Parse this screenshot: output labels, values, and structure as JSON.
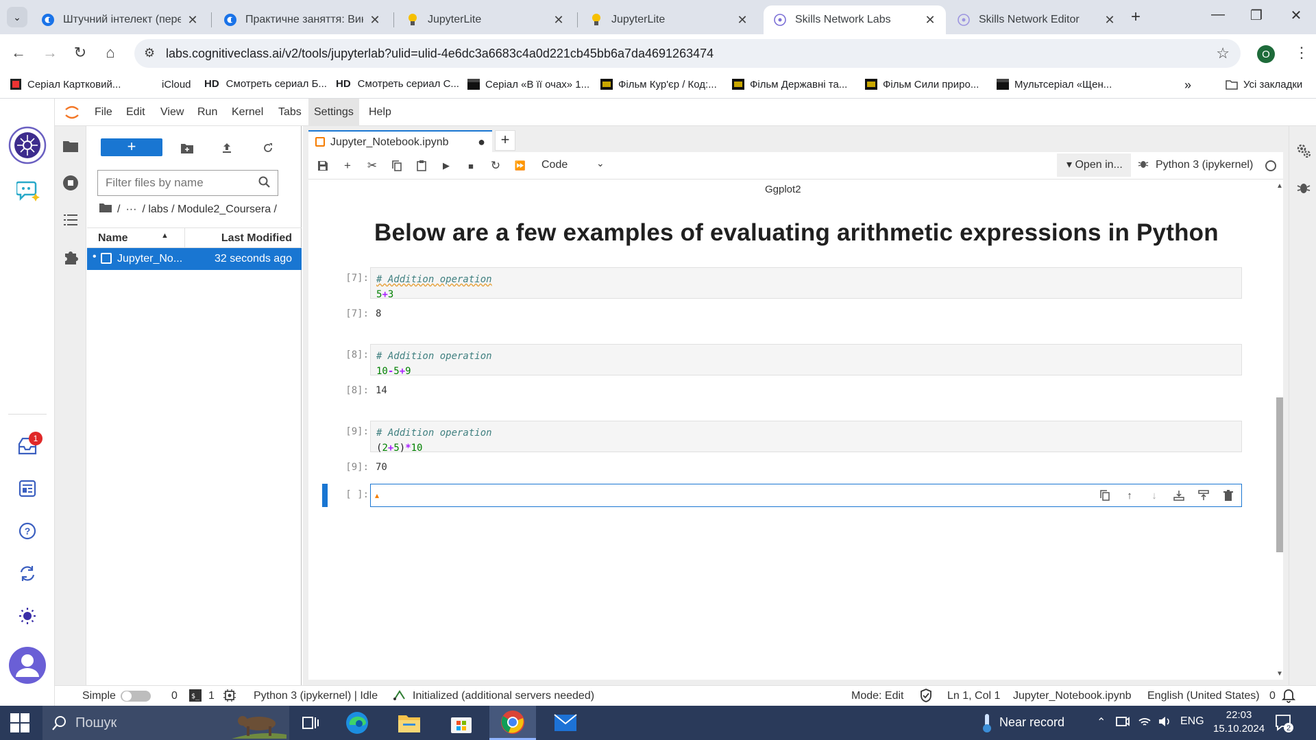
{
  "browser": {
    "tabs": [
      {
        "title": "Штучний інтелект (перекл",
        "icon": "coursera-icon",
        "active": false
      },
      {
        "title": "Практичне заняття: Викор",
        "icon": "coursera-icon",
        "active": false
      },
      {
        "title": "JupyterLite",
        "icon": "jupyterlite-icon",
        "active": false
      },
      {
        "title": "JupyterLite",
        "icon": "jupyterlite-icon",
        "active": false
      },
      {
        "title": "Skills Network Labs",
        "icon": "skills-network-icon",
        "active": true
      },
      {
        "title": "Skills Network Editor",
        "icon": "skills-network-icon",
        "active": false
      }
    ],
    "url": "labs.cognitiveclass.ai/v2/tools/jupyterlab?ulid=ulid-4e6dc3a6683c4a0d221cb45bb6a7da4691263474",
    "profile_initial": "O",
    "bookmarks": [
      {
        "label": "Серіал Картковий...",
        "icon": "youtube-icon"
      },
      {
        "label": "iCloud",
        "icon": "apple-icon"
      },
      {
        "label": "Смотреть сериал Б...",
        "prefix": "HD"
      },
      {
        "label": "Смотреть сериал С...",
        "prefix": "HD"
      },
      {
        "label": "Серіал «В її очах» 1...",
        "icon": "clapper-icon"
      },
      {
        "label": "Фільм Кур'єр / Код:...",
        "icon": "film-icon"
      },
      {
        "label": "Фільм Державні та...",
        "icon": "film-icon"
      },
      {
        "label": "Фільм Сили приро...",
        "icon": "film-icon"
      },
      {
        "label": "Мультсеріал «Щен...",
        "icon": "clapper-icon"
      }
    ],
    "bookmarks_overflow": "»",
    "all_bookmarks": "Усі закладки"
  },
  "menu": {
    "items": [
      "File",
      "Edit",
      "View",
      "Run",
      "Kernel",
      "Tabs",
      "Settings",
      "Help"
    ]
  },
  "sn_rail": {
    "badge_count": "1"
  },
  "filebrowser": {
    "new_label": "+",
    "filter_placeholder": "Filter files by name",
    "breadcrumb": {
      "root": "/",
      "ellipsis": "···",
      "path": "/ labs / Module2_Coursera /"
    },
    "headers": {
      "name": "Name",
      "modified": "Last Modified"
    },
    "files": [
      {
        "name": "Jupyter_No...",
        "modified": "32 seconds ago",
        "selected": true
      }
    ]
  },
  "notebook": {
    "tab_title": "Jupyter_Notebook.ipynb",
    "dirty_marker": "●",
    "cell_type": "Code",
    "open_in": "▾ Open in...",
    "kernel": "Python 3 (ipykernel)",
    "top_text": "Ggplot2",
    "heading": "Below are a few examples of evaluating arithmetic expressions in Python",
    "cells": [
      {
        "in_prompt": "[7]:",
        "comment": "# Addition operation",
        "code": [
          "5",
          "+",
          "3"
        ],
        "out_prompt": "[7]:",
        "output": "8"
      },
      {
        "in_prompt": "[8]:",
        "comment": "# Addition operation",
        "code": [
          "10",
          "-",
          "5",
          "+",
          "9"
        ],
        "out_prompt": "[8]:",
        "output": "14"
      },
      {
        "in_prompt": "[9]:",
        "comment": "# Addition operation",
        "code": [
          "(",
          "2",
          "+",
          "5",
          ")",
          "*",
          "10"
        ],
        "out_prompt": "[9]:",
        "output": "70"
      }
    ],
    "empty_prompt": "[ ]:"
  },
  "statusbar": {
    "mode_label": "Simple",
    "terminals": "0",
    "kernels": "1",
    "kernel_status": "Python 3 (ipykernel) | Idle",
    "lsp": "Initialized (additional servers needed)",
    "mode": "Mode: Edit",
    "position": "Ln 1, Col 1",
    "filename": "Jupyter_Notebook.ipynb",
    "language": "English (United States)",
    "notifications": "0"
  },
  "taskbar": {
    "search_placeholder": "Пошук",
    "weather": "Near record",
    "lang": "ENG",
    "time": "22:03",
    "date": "15.10.2024",
    "notif_count": "2"
  },
  "colors": {
    "accent": "#1976d2",
    "tab_strip": "#dfe3eb",
    "taskbar": "#2a3a5a",
    "jupyter_orange": "#f57c00"
  }
}
